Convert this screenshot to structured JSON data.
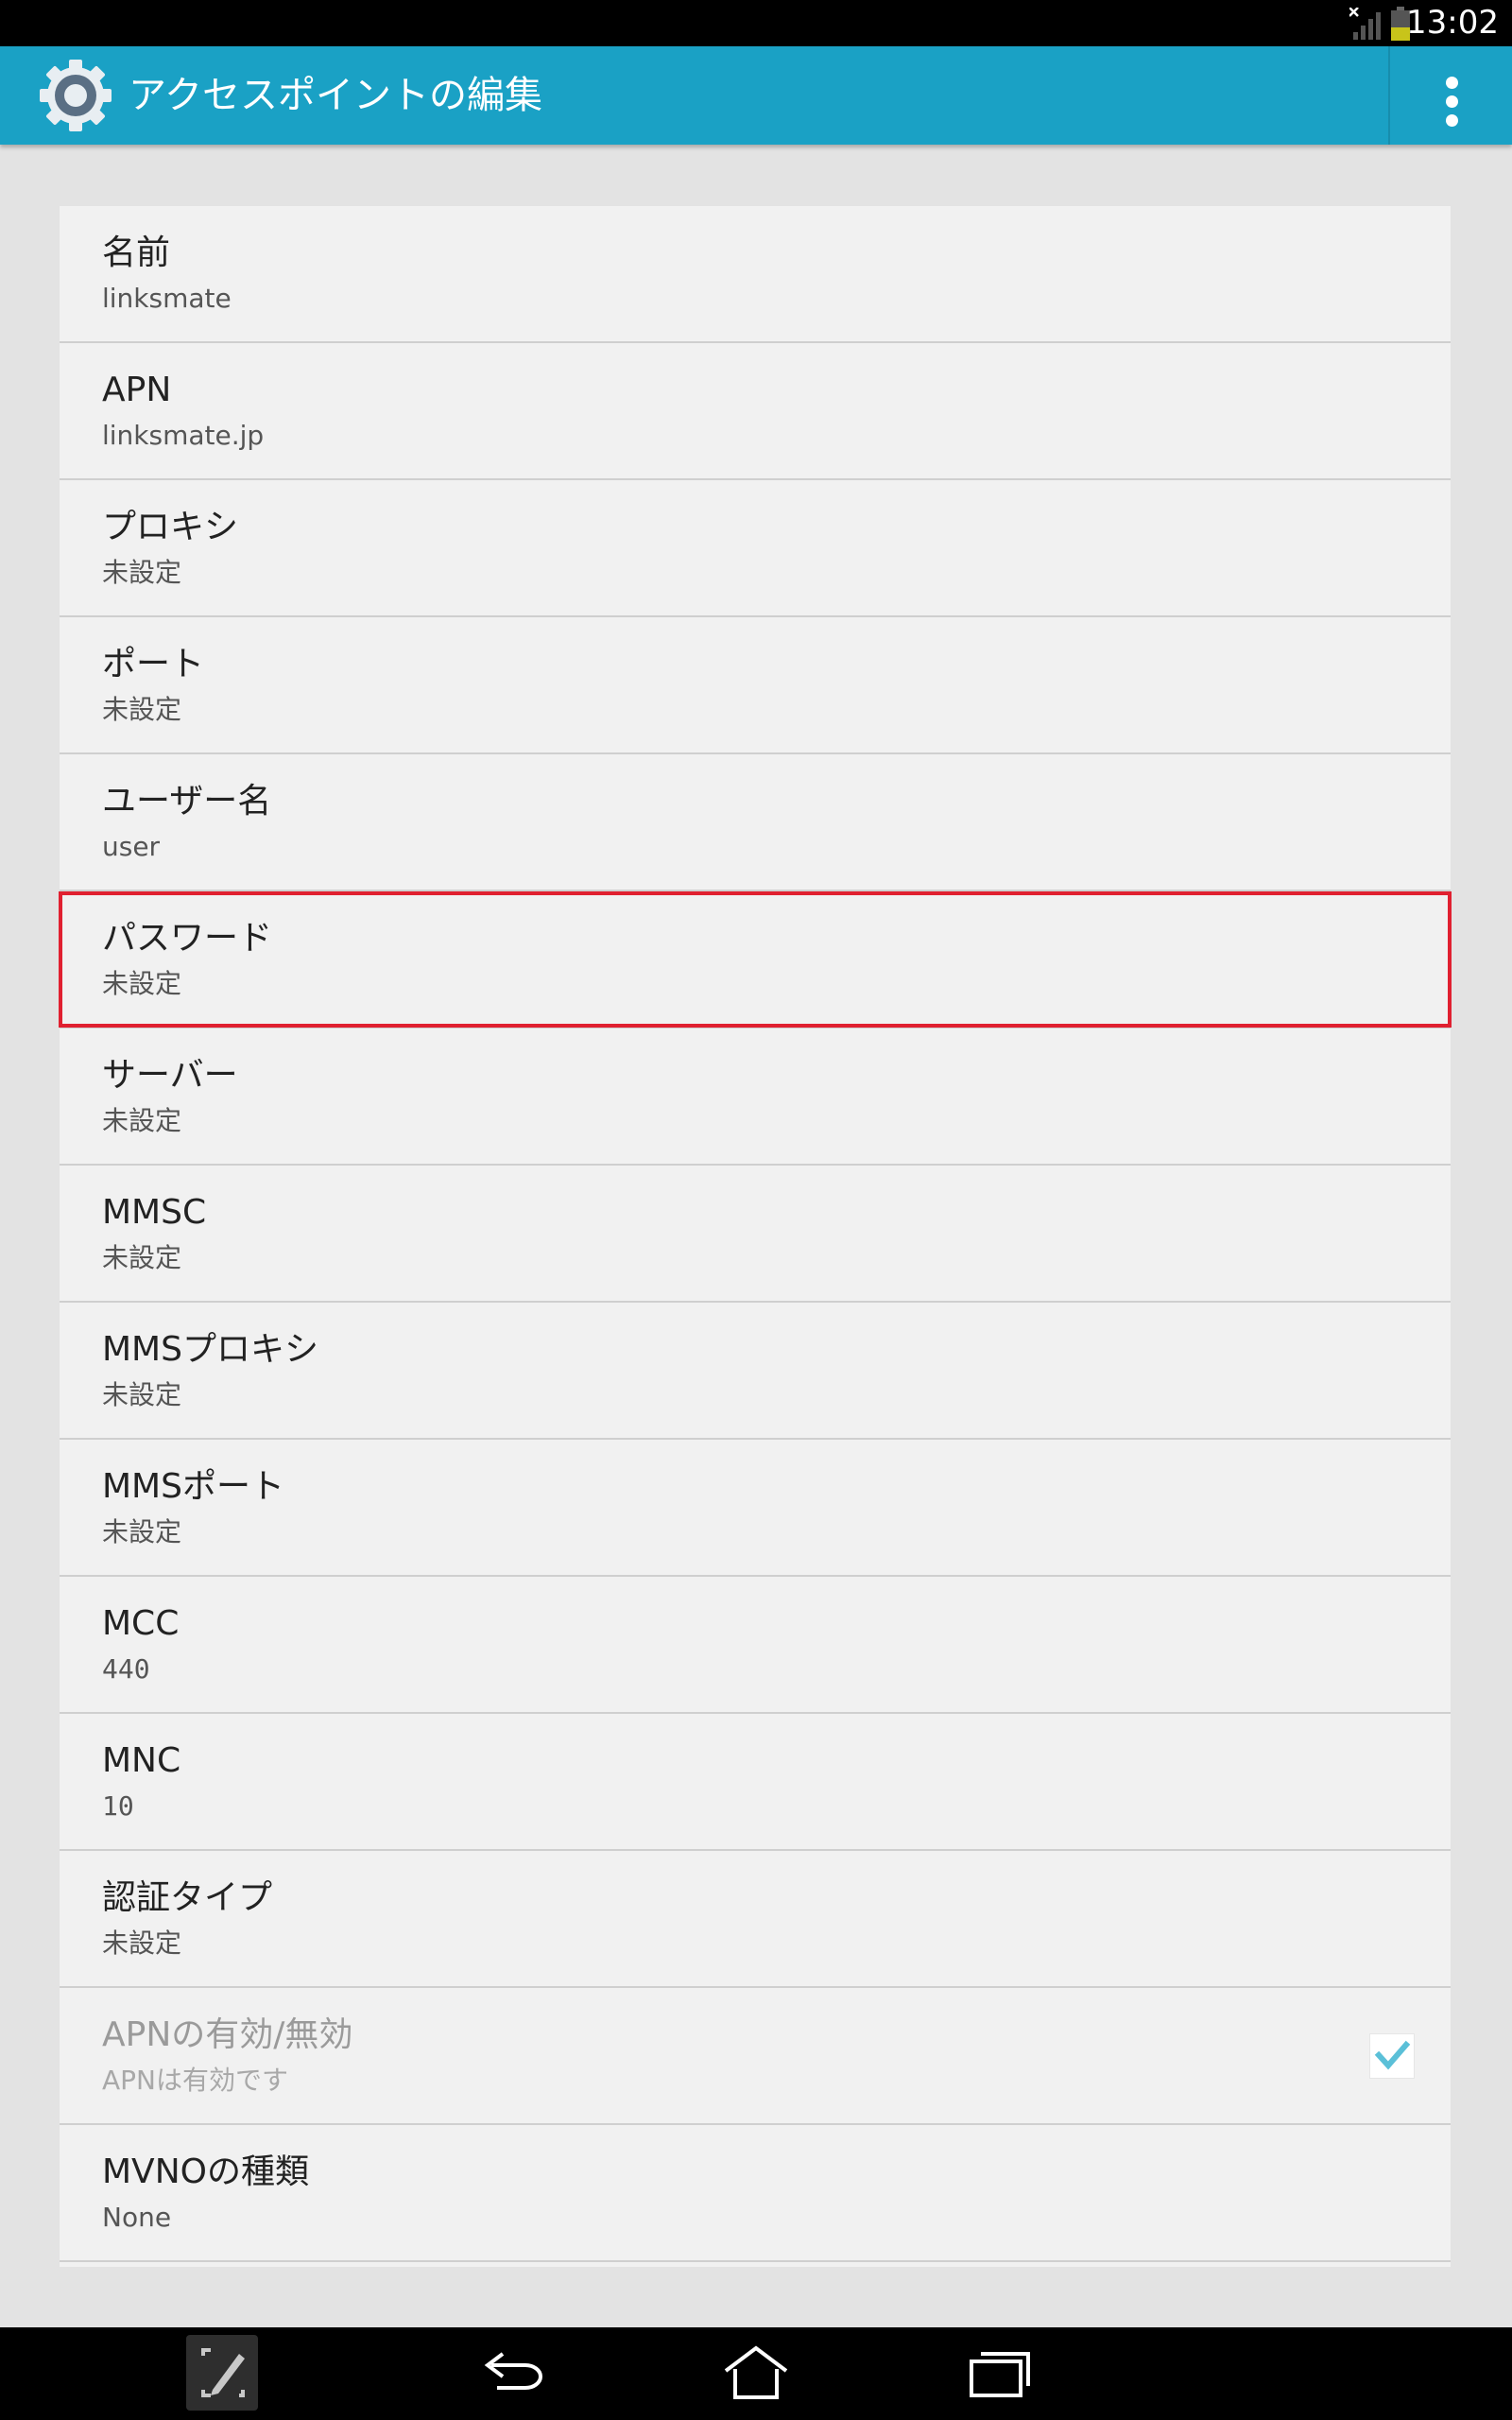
{
  "status_bar": {
    "time": "13:02"
  },
  "header": {
    "title": "アクセスポイントの編集"
  },
  "items": [
    {
      "title": "名前",
      "summary": "linksmate"
    },
    {
      "title": "APN",
      "summary": "linksmate.jp"
    },
    {
      "title": "プロキシ",
      "summary": "未設定"
    },
    {
      "title": "ポート",
      "summary": "未設定"
    },
    {
      "title": "ユーザー名",
      "summary": "user"
    },
    {
      "title": "パスワード",
      "summary": "未設定"
    },
    {
      "title": "サーバー",
      "summary": "未設定"
    },
    {
      "title": "MMSC",
      "summary": "未設定"
    },
    {
      "title": "MMSプロキシ",
      "summary": "未設定"
    },
    {
      "title": "MMSポート",
      "summary": "未設定"
    },
    {
      "title": "MCC",
      "summary": "440"
    },
    {
      "title": "MNC",
      "summary": "10"
    },
    {
      "title": "認証タイプ",
      "summary": "未設定"
    },
    {
      "title": "APNの有効/無効",
      "summary": "APNは有効です",
      "checked": true
    },
    {
      "title": "MVNOの種類",
      "summary": "None"
    }
  ],
  "colors": {
    "action_bar": "#1aa1c5",
    "highlight": "#e02030",
    "checkmark": "#5bc0d8"
  },
  "icons": {
    "app": "gear-icon",
    "overflow": "more-vert-icon",
    "nav_left": "screen-write-icon",
    "nav_back": "back-icon",
    "nav_home": "home-icon",
    "nav_recent": "recent-apps-icon"
  }
}
